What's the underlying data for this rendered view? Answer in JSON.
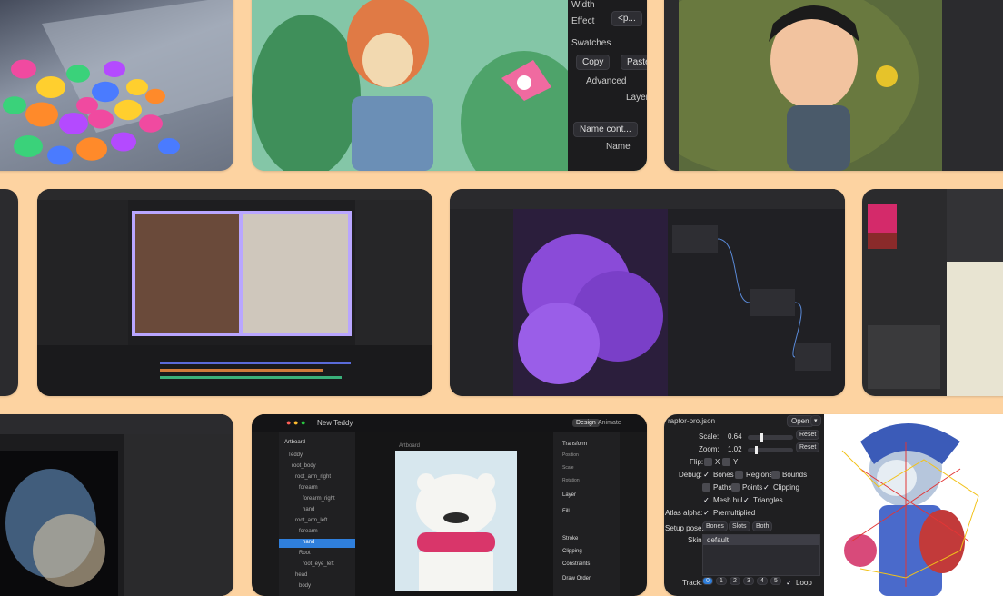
{
  "tile_b": {
    "menu": [
      "Width",
      "Effect",
      "Swatches",
      "Copy",
      "Paste",
      "Advanced",
      "Layers",
      "Name cont...",
      "Name"
    ],
    "dropdown": "<p..."
  },
  "tile_f": {
    "tabs": [
      "Design",
      "Animate"
    ],
    "app_title": "New Teddy",
    "tree": [
      "Artboard",
      "Teddy",
      "root_body",
      "root_arm_right",
      "forearm",
      "forearm_right",
      "hand",
      "root_arm_left",
      "forearm",
      "hand",
      "Root",
      "root_eye_left",
      "head",
      "body",
      "belly"
    ],
    "props": [
      "Transform",
      "Position",
      "Scale",
      "Rotation",
      "Layer",
      "Fill",
      "Stroke",
      "Clipping",
      "Constraints",
      "Draw Order"
    ],
    "canvas_label": "Artboard"
  },
  "spine": {
    "file": "raptor-pro.json",
    "open_label": "Open",
    "scale_label": "Scale:",
    "scale_value": "0.64",
    "zoom_label": "Zoom:",
    "zoom_value": "1.02",
    "reset_label": "Reset",
    "flip_label": "Flip:",
    "flip_x": "X",
    "flip_y": "Y",
    "debug_label": "Debug:",
    "bones": "Bones",
    "regions": "Regions",
    "bounds": "Bounds",
    "paths": "Paths",
    "points": "Points",
    "clipping": "Clipping",
    "mesh_hull": "Mesh hull",
    "triangles": "Triangles",
    "atlas_label": "Atlas alpha:",
    "premultiplied": "Premultiplied",
    "setup_label": "Setup pose:",
    "setup_bones": "Bones",
    "setup_slots": "Slots",
    "setup_both": "Both",
    "skin_label": "Skin:",
    "skin_value": "default",
    "track_label": "Track:",
    "tracks": [
      "0",
      "1",
      "2",
      "3",
      "4",
      "5"
    ],
    "loop": "Loop"
  },
  "colors": {
    "page_bg": "#fdd3a1",
    "dark_panel": "#1f1f22",
    "accent_blue": "#2f7fdc",
    "accent_purple": "#8a4bd8"
  }
}
